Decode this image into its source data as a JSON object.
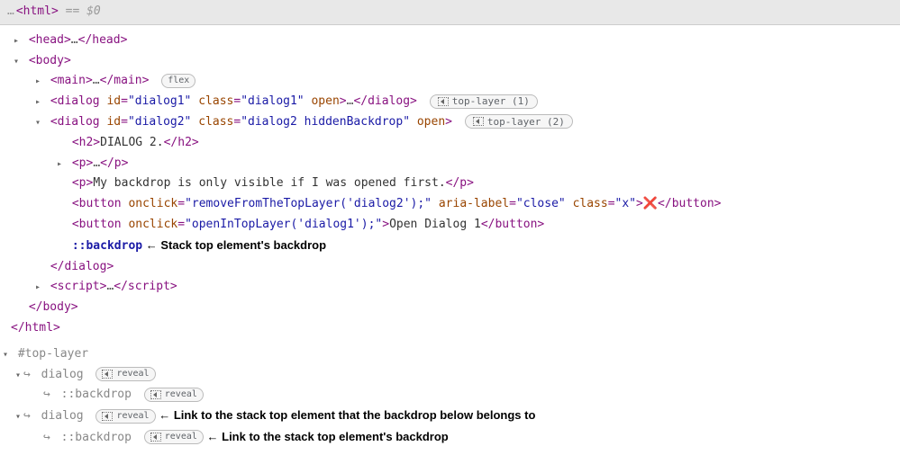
{
  "topbar": {
    "dots": "…",
    "openHtml": "<html>",
    "eqSel": " == $0"
  },
  "tree": {
    "head": {
      "open": "<head>",
      "ell": "…",
      "close": "</head>"
    },
    "body": {
      "open": "<body>",
      "close": "</body>"
    },
    "main": {
      "open": "<main>",
      "ell": "…",
      "close": "</main>",
      "badge": "flex"
    },
    "dialog1": {
      "lt": "<",
      "tag": "dialog",
      "idAttr": "id",
      "idVal": "\"dialog1\"",
      "classAttr": "class",
      "classVal": "\"dialog1\"",
      "openAttr": "open",
      "gt": ">",
      "ell": "…",
      "closeTag": "</dialog>",
      "badgeIconAlt": "top-layer-icon",
      "badgeText": "top-layer (1)"
    },
    "dialog2": {
      "lt": "<",
      "tag": "dialog",
      "idAttr": "id",
      "idVal": "\"dialog2\"",
      "classAttr": "class",
      "classVal": "\"dialog2 hiddenBackdrop\"",
      "openAttr": "open",
      "gt": ">",
      "badgeText": "top-layer (2)",
      "h2": {
        "open": "<h2>",
        "text": "DIALOG 2.",
        "close": "</h2>"
      },
      "pCollapsed": {
        "open": "<p>",
        "ell": "…",
        "close": "</p>"
      },
      "pText": {
        "open": "<p>",
        "text": "My backdrop is only visible if I was opened first.",
        "close": "</p>"
      },
      "btn1": {
        "lt": "<",
        "tag": "button",
        "onclickAttr": "onclick",
        "onclickVal": "\"removeFromTheTopLayer('dialog2');\"",
        "ariaAttr": "aria-label",
        "ariaVal": "\"close\"",
        "classAttr": "class",
        "classVal": "\"x\"",
        "gt": ">",
        "content": "❌",
        "close": "</button>"
      },
      "btn2": {
        "lt": "<",
        "tag": "button",
        "onclickAttr": "onclick",
        "onclickVal": "\"openInTopLayer('dialog1');\"",
        "gt": ">",
        "content": "Open Dialog 1",
        "close": "</button>"
      },
      "backdrop": {
        "pseudo": "::backdrop",
        "arrow": " ← ",
        "note": "Stack top element's backdrop"
      },
      "closeTag": "</dialog>"
    },
    "script": {
      "open": "<script>",
      "ell": "…",
      "close": "</script>"
    },
    "closeHtml": "</html>"
  },
  "topLayer": {
    "header": "#top-layer",
    "rows": [
      {
        "indent": 1,
        "toggle": "down",
        "arrow": "↪",
        "word": "dialog",
        "revealBadge": "reveal",
        "note": ""
      },
      {
        "indent": 2,
        "toggle": "",
        "arrow": "↪",
        "word": "::backdrop",
        "revealBadge": "reveal",
        "note": ""
      },
      {
        "indent": 1,
        "toggle": "down",
        "arrow": "↪",
        "word": "dialog",
        "revealBadge": "reveal",
        "note": "Link to the stack top element that the backdrop below belongs to"
      },
      {
        "indent": 2,
        "toggle": "",
        "arrow": "↪",
        "word": "::backdrop",
        "revealBadge": "reveal",
        "note": "Link to the stack top element's backdrop"
      }
    ],
    "arrowGlyph": " ← "
  }
}
